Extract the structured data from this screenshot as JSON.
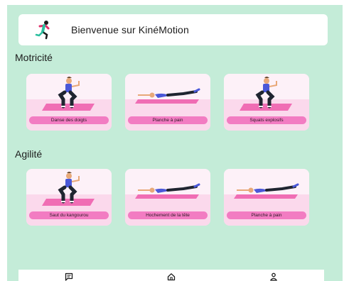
{
  "header": {
    "title": "Bienvenue sur KinéMotion",
    "logo_icon": "runner-logo-icon"
  },
  "sections": [
    {
      "title": "Motricité",
      "cards": [
        {
          "label": "Danse des doigts",
          "pose": "squat"
        },
        {
          "label": "Planche à pain",
          "pose": "plank"
        },
        {
          "label": "Squats explosifs",
          "pose": "squat"
        }
      ]
    },
    {
      "title": "Agilité",
      "cards": [
        {
          "label": "Saut du kangourou",
          "pose": "squat"
        },
        {
          "label": "Hochement de la tête",
          "pose": "plank"
        },
        {
          "label": "Planche à pain",
          "pose": "plank"
        }
      ]
    }
  ],
  "bottom_nav": [
    {
      "icon": "message-icon"
    },
    {
      "icon": "home-icon"
    },
    {
      "icon": "profile-icon"
    }
  ],
  "colors": {
    "background": "#c4ecd8",
    "card": "#fbe4f1",
    "label_pill": "#f27cc2",
    "mat": "#f06db4",
    "shirt": "#4a58d8",
    "pants": "#1f2530"
  }
}
